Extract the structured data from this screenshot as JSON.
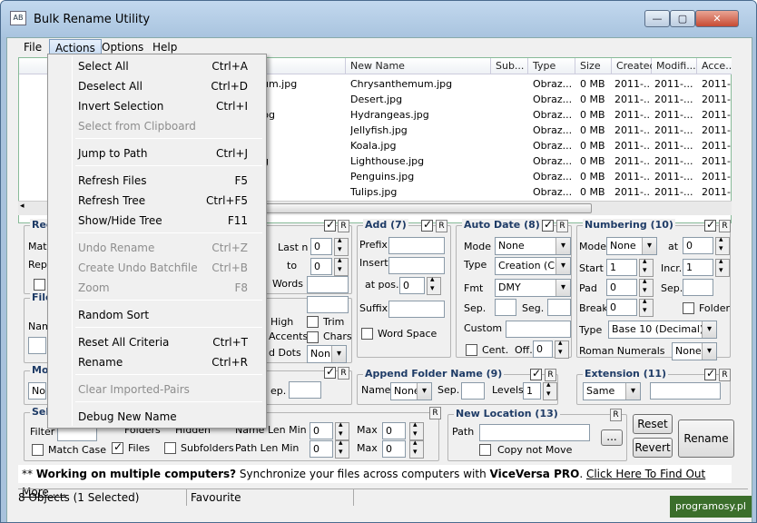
{
  "window": {
    "title": "Bulk Rename Utility",
    "app_icon": "AB"
  },
  "menubar": [
    "File",
    "Actions",
    "Options",
    "Help"
  ],
  "file_list": {
    "columns": [
      "New Name",
      "Sub...",
      "Type",
      "Size",
      "Created",
      "Modifi...",
      "Acce..."
    ],
    "rows": [
      {
        "name_tail": "um.jpg",
        "new_name": "Chrysanthemum.jpg",
        "type": "Obraz...",
        "size": "0 MB",
        "created": "2011-...",
        "modified": "2011-...",
        "accessed": "2011-..."
      },
      {
        "name_tail": "",
        "new_name": "Desert.jpg",
        "type": "Obraz...",
        "size": "0 MB",
        "created": "2011-...",
        "modified": "2011-...",
        "accessed": "2011-..."
      },
      {
        "name_tail": "pg",
        "new_name": "Hydrangeas.jpg",
        "type": "Obraz...",
        "size": "0 MB",
        "created": "2011-...",
        "modified": "2011-...",
        "accessed": "2011-..."
      },
      {
        "name_tail": "",
        "new_name": "Jellyfish.jpg",
        "type": "Obraz...",
        "size": "0 MB",
        "created": "2011-...",
        "modified": "2011-...",
        "accessed": "2011-..."
      },
      {
        "name_tail": "",
        "new_name": "Koala.jpg",
        "type": "Obraz...",
        "size": "0 MB",
        "created": "2011-...",
        "modified": "2011-...",
        "accessed": "2011-..."
      },
      {
        "name_tail": "g",
        "new_name": "Lighthouse.jpg",
        "type": "Obraz...",
        "size": "0 MB",
        "created": "2011-...",
        "modified": "2011-...",
        "accessed": "2011-..."
      },
      {
        "name_tail": "",
        "new_name": "Penguins.jpg",
        "type": "Obraz...",
        "size": "0 MB",
        "created": "2011-...",
        "modified": "2011-...",
        "accessed": "2011-..."
      },
      {
        "name_tail": "",
        "new_name": "Tulips.jpg",
        "type": "Obraz...",
        "size": "0 MB",
        "created": "2011-...",
        "modified": "2011-...",
        "accessed": "2011-..."
      }
    ]
  },
  "actions_menu": [
    {
      "label": "Select All",
      "key": "Ctrl+A",
      "disabled": false
    },
    {
      "label": "Deselect All",
      "key": "Ctrl+D",
      "disabled": false
    },
    {
      "label": "Invert Selection",
      "key": "Ctrl+I",
      "disabled": false
    },
    {
      "label": "Select from Clipboard",
      "key": "",
      "disabled": true
    },
    {
      "label": "Jump to Path",
      "key": "Ctrl+J",
      "disabled": false
    },
    {
      "label": "Refresh Files",
      "key": "F5",
      "disabled": false
    },
    {
      "label": "Refresh Tree",
      "key": "Ctrl+F5",
      "disabled": false
    },
    {
      "label": "Show/Hide Tree",
      "key": "F11",
      "disabled": false
    },
    {
      "label": "Undo Rename",
      "key": "Ctrl+Z",
      "disabled": true
    },
    {
      "label": "Create Undo Batchfile",
      "key": "Ctrl+B",
      "disabled": true
    },
    {
      "label": "Zoom",
      "key": "F8",
      "disabled": true
    },
    {
      "label": "Random Sort",
      "key": "",
      "disabled": false
    },
    {
      "label": "Reset All Criteria",
      "key": "Ctrl+T",
      "disabled": false
    },
    {
      "label": "Rename",
      "key": "Ctrl+R",
      "disabled": false
    },
    {
      "label": "Clear Imported-Pairs",
      "key": "",
      "disabled": true
    },
    {
      "label": "Debug New Name",
      "key": "",
      "disabled": false
    }
  ],
  "partial": {
    "regex": "Reg",
    "match": "Matc",
    "repl": "Repl",
    "file": "File",
    "name": "Nam",
    "mo": "Mo",
    "no": "No",
    "sel": "Sel",
    "filter": "Filter",
    "folders": "Folders",
    "hidden": "Hidden",
    "name_len_min_prefix": "Name Len Min",
    "last_n": "Last n",
    "to": "to",
    "words": "Words",
    "high": "High",
    "trim": "Trim",
    "accents": "Accents",
    "chars": "Chars",
    "d_dots": "d Dots",
    "non": "Non",
    "sep": "ep."
  },
  "add_panel": {
    "title": "Add (7)",
    "prefix": "Prefix",
    "insert": "Insert",
    "at_pos": "at pos.",
    "at_pos_value": "0",
    "suffix": "Suffix",
    "word_space": "Word Space"
  },
  "autodate_panel": {
    "title": "Auto Date (8)",
    "mode_label": "Mode",
    "mode": "None",
    "type_label": "Type",
    "type": "Creation (Cur",
    "fmt_label": "Fmt",
    "fmt": "DMY",
    "sep": "Sep.",
    "seg": "Seg.",
    "custom": "Custom",
    "cent": "Cent.",
    "off": "Off.",
    "off_value": "0"
  },
  "numbering_panel": {
    "title": "Numbering (10)",
    "mode_label": "Mode",
    "mode": "None",
    "at": "at",
    "at_value": "0",
    "start": "Start",
    "start_value": "1",
    "incr": "Incr.",
    "incr_value": "1",
    "pad": "Pad",
    "pad_value": "0",
    "sep": "Sep.",
    "break": "Break",
    "break_value": "0",
    "folder": "Folder",
    "type_label": "Type",
    "type": "Base 10 (Decimal)",
    "roman": "Roman Numerals",
    "roman_value": "None"
  },
  "append_folder_panel": {
    "title": "Append Folder Name (9)",
    "name_label": "Name",
    "name": "None",
    "sep": "Sep.",
    "levels": "Levels",
    "levels_value": "1"
  },
  "extension_panel": {
    "title": "Extension (11)",
    "mode": "Same"
  },
  "new_location_panel": {
    "title": "New Location (13)",
    "path": "Path",
    "browse": "...",
    "copy_not_move": "Copy not Move"
  },
  "selections": {
    "match_case": "Match Case",
    "files": "Files",
    "subfolders": "Subfolders",
    "name_len_min": "Name Len Min",
    "path_len_min": "Path Len Min",
    "max": "Max",
    "zero": "0"
  },
  "buttons": {
    "reset": "Reset",
    "revert": "Revert",
    "rename": "Rename",
    "r": "R"
  },
  "ad": {
    "prefix": "** ",
    "bold1": "Working on multiple computers?",
    "mid": " Synchronize your files across computers with ",
    "bold2": "ViceVersa PRO",
    "mid2": ". ",
    "link": "Click Here To Find Out More ...."
  },
  "status": {
    "objects": "8 Objects (1 Selected)",
    "favourite": "Favourite"
  },
  "watermark": "programosy.pl",
  "colors": {
    "accent": "#1e3b66",
    "titlebar": "#a9c4df",
    "watermark": "#3b6e2b"
  }
}
